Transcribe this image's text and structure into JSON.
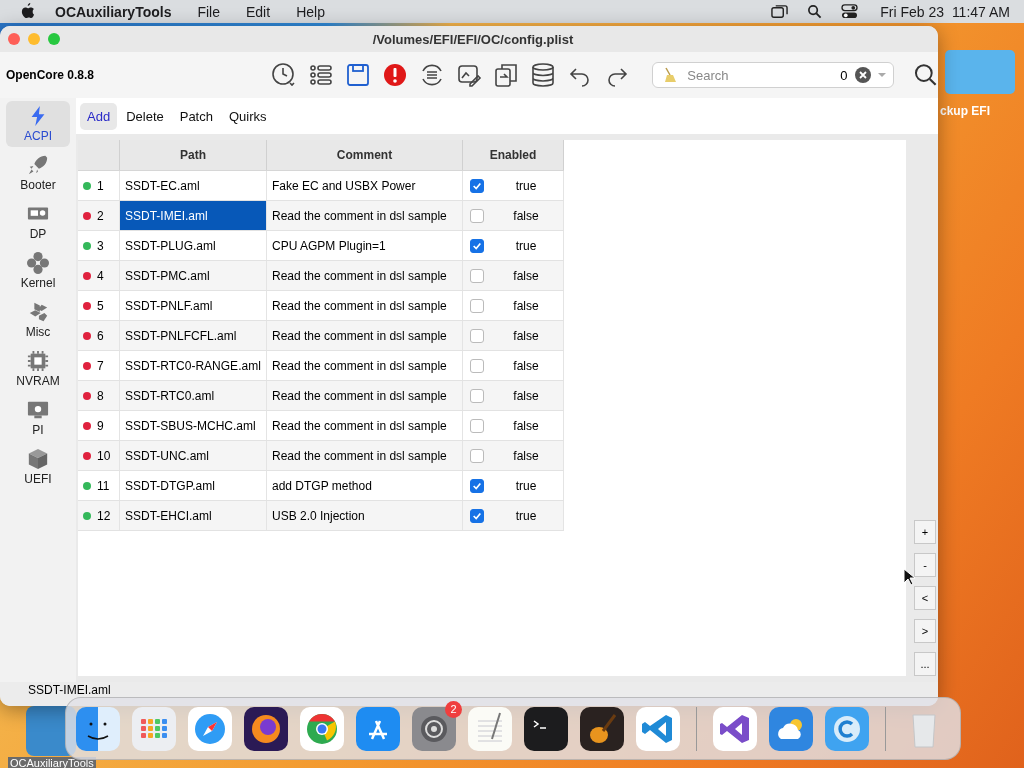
{
  "menubar": {
    "app": "OCAuxiliaryTools",
    "menus": [
      "File",
      "Edit",
      "Help"
    ],
    "clock": "Fri Feb 23  11:47 AM"
  },
  "desktop": {
    "folder_label": "ckup EFI",
    "app_label": "OCAuxiliaryTools"
  },
  "window": {
    "title": "/Volumes/EFI/EFI/OC/config.plist",
    "version": "OpenCore 0.8.8",
    "search": {
      "placeholder": "Search",
      "count": "0"
    }
  },
  "sidebar": [
    {
      "label": "ACPI",
      "selected": true
    },
    {
      "label": "Booter",
      "selected": false
    },
    {
      "label": "DP",
      "selected": false
    },
    {
      "label": "Kernel",
      "selected": false
    },
    {
      "label": "Misc",
      "selected": false
    },
    {
      "label": "NVRAM",
      "selected": false
    },
    {
      "label": "PI",
      "selected": false
    },
    {
      "label": "UEFI",
      "selected": false
    }
  ],
  "tabs": [
    {
      "label": "Add",
      "selected": true
    },
    {
      "label": "Delete",
      "selected": false
    },
    {
      "label": "Patch",
      "selected": false
    },
    {
      "label": "Quirks",
      "selected": false
    }
  ],
  "table": {
    "columns": [
      "Path",
      "Comment",
      "Enabled"
    ],
    "rows": [
      {
        "index": "1",
        "color": "#34b85a",
        "path": "SSDT-EC.aml",
        "comment": "Fake EC and USBX Power",
        "enabled": true,
        "value": "true",
        "selected": false
      },
      {
        "index": "2",
        "color": "#e0223e",
        "path": "SSDT-IMEI.aml",
        "comment": "Read the comment in dsl sample",
        "enabled": false,
        "value": "false",
        "selected": true
      },
      {
        "index": "3",
        "color": "#34b85a",
        "path": "SSDT-PLUG.aml",
        "comment": "CPU AGPM Plugin=1",
        "enabled": true,
        "value": "true",
        "selected": false
      },
      {
        "index": "4",
        "color": "#e0223e",
        "path": "SSDT-PMC.aml",
        "comment": "Read the comment in dsl sample",
        "enabled": false,
        "value": "false",
        "selected": false
      },
      {
        "index": "5",
        "color": "#e0223e",
        "path": "SSDT-PNLF.aml",
        "comment": "Read the comment in dsl sample",
        "enabled": false,
        "value": "false",
        "selected": false
      },
      {
        "index": "6",
        "color": "#e0223e",
        "path": "SSDT-PNLFCFL.aml",
        "comment": "Read the comment in dsl sample",
        "enabled": false,
        "value": "false",
        "selected": false
      },
      {
        "index": "7",
        "color": "#e0223e",
        "path": "SSDT-RTC0-RANGE.aml",
        "comment": "Read the comment in dsl sample",
        "enabled": false,
        "value": "false",
        "selected": false
      },
      {
        "index": "8",
        "color": "#e0223e",
        "path": "SSDT-RTC0.aml",
        "comment": "Read the comment in dsl sample",
        "enabled": false,
        "value": "false",
        "selected": false
      },
      {
        "index": "9",
        "color": "#e0223e",
        "path": "SSDT-SBUS-MCHC.aml",
        "comment": "Read the comment in dsl sample",
        "enabled": false,
        "value": "false",
        "selected": false
      },
      {
        "index": "10",
        "color": "#e0223e",
        "path": "SSDT-UNC.aml",
        "comment": "Read the comment in dsl sample",
        "enabled": false,
        "value": "false",
        "selected": false
      },
      {
        "index": "11",
        "color": "#34b85a",
        "path": "SSDT-DTGP.aml",
        "comment": "add DTGP method",
        "enabled": true,
        "value": "true",
        "selected": false
      },
      {
        "index": "12",
        "color": "#34b85a",
        "path": "SSDT-EHCI.aml",
        "comment": "USB 2.0 Injection",
        "enabled": true,
        "value": "true",
        "selected": false
      }
    ]
  },
  "side_buttons": [
    "+",
    "-",
    "<",
    ">",
    "..."
  ],
  "status_bar": "SSDT-IMEI.aml",
  "dock": [
    {
      "kind": "finder"
    },
    {
      "kind": "launchpad"
    },
    {
      "kind": "safari"
    },
    {
      "kind": "firefox"
    },
    {
      "kind": "chrome"
    },
    {
      "kind": "appstore"
    },
    {
      "kind": "settings",
      "badge": "2"
    },
    {
      "kind": "textedit"
    },
    {
      "kind": "terminal"
    },
    {
      "kind": "garageband"
    },
    {
      "kind": "vscode"
    },
    {
      "kind": "divider"
    },
    {
      "kind": "visualstudio"
    },
    {
      "kind": "weather"
    },
    {
      "kind": "ocat"
    },
    {
      "kind": "divider"
    },
    {
      "kind": "trash"
    }
  ]
}
